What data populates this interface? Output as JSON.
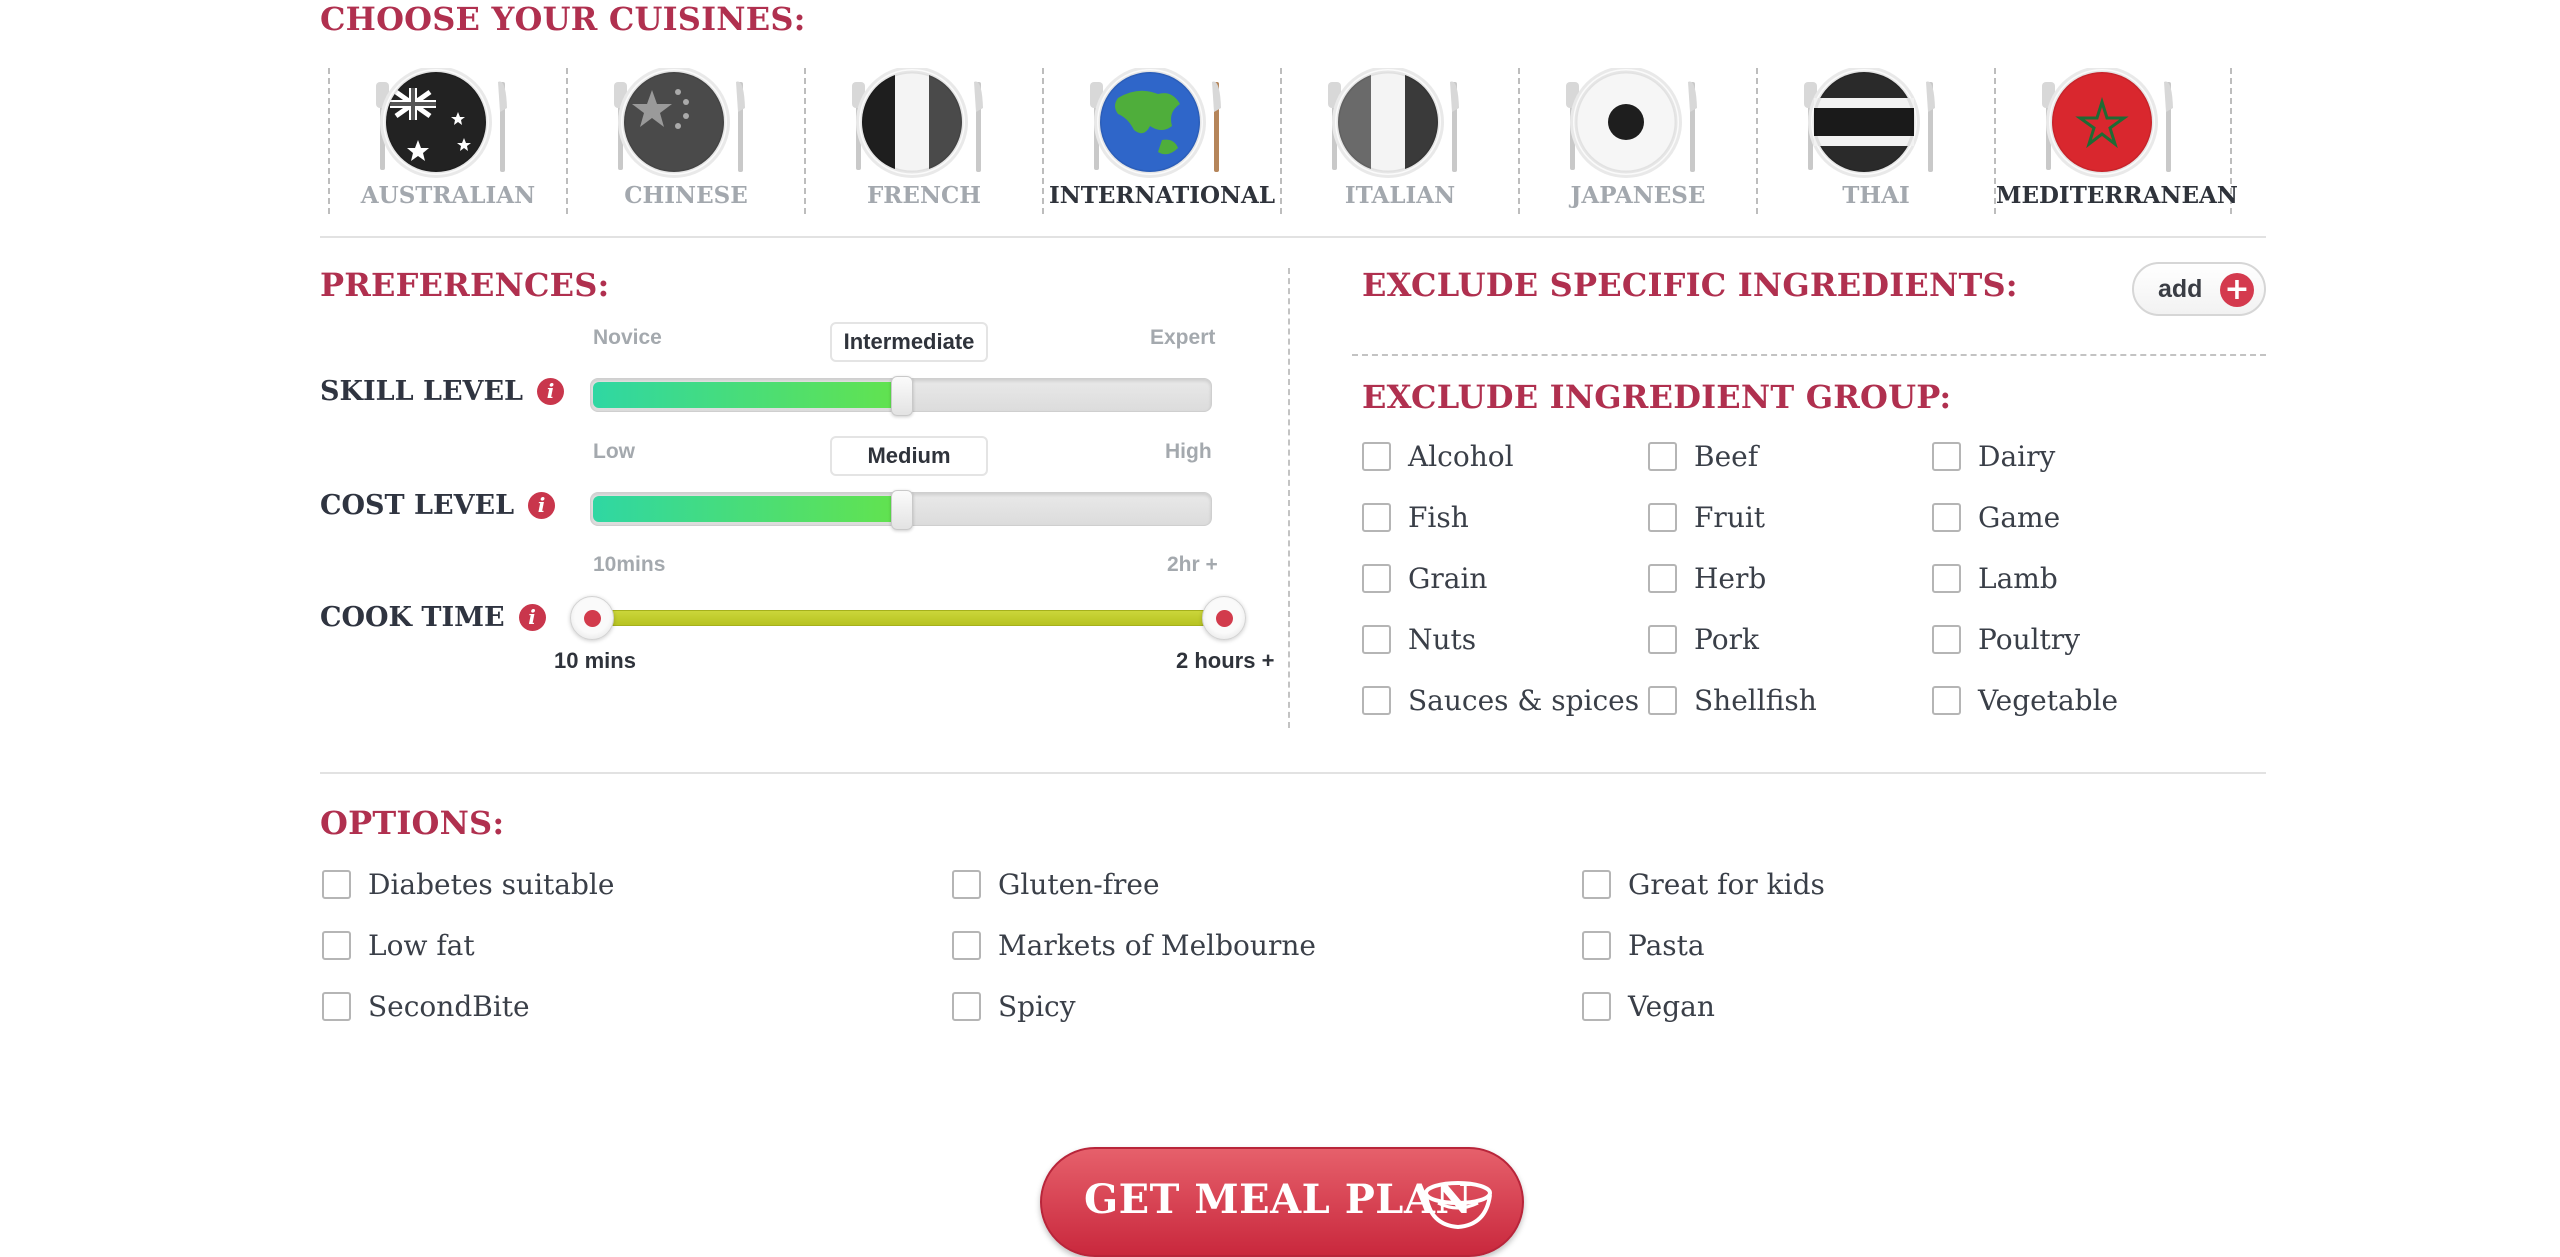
{
  "cuisines": {
    "title": "CHOOSE YOUR CUISINES:",
    "items": [
      {
        "label": "AUSTRALIAN",
        "selected": false,
        "icon": "australia-flag-plate-icon"
      },
      {
        "label": "CHINESE",
        "selected": false,
        "icon": "china-flag-plate-icon"
      },
      {
        "label": "FRENCH",
        "selected": false,
        "icon": "france-flag-plate-icon"
      },
      {
        "label": "INTERNATIONAL",
        "selected": true,
        "icon": "globe-plate-icon"
      },
      {
        "label": "ITALIAN",
        "selected": false,
        "icon": "italy-flag-plate-icon"
      },
      {
        "label": "JAPANESE",
        "selected": false,
        "icon": "japan-flag-plate-icon"
      },
      {
        "label": "THAI",
        "selected": false,
        "icon": "thailand-flag-plate-icon"
      },
      {
        "label": "MEDITERRANEAN",
        "selected": true,
        "icon": "morocco-flag-plate-icon"
      }
    ]
  },
  "preferences": {
    "title": "PREFERENCES:",
    "skill": {
      "label": "SKILL LEVEL",
      "min": "Novice",
      "max": "Expert",
      "value": "Intermediate",
      "level": 0.5
    },
    "cost": {
      "label": "COST LEVEL",
      "min": "Low",
      "max": "High",
      "value": "Medium",
      "level": 0.5
    },
    "cook": {
      "label": "COOK TIME",
      "min": "10mins",
      "max": "2hr +",
      "from": "10 mins",
      "to": "2 hours +"
    },
    "info_glyph": "i"
  },
  "exclude_ingredients": {
    "title": "EXCLUDE SPECIFIC INGREDIENTS:",
    "add_label": "add",
    "add_glyph": "+"
  },
  "exclude_groups": {
    "title": "EXCLUDE INGREDIENT GROUP:",
    "items": [
      "Alcohol",
      "Beef",
      "Dairy",
      "Fish",
      "Fruit",
      "Game",
      "Grain",
      "Herb",
      "Lamb",
      "Nuts",
      "Pork",
      "Poultry",
      "Sauces & spices",
      "Shellfish",
      "Vegetable"
    ]
  },
  "options": {
    "title": "OPTIONS:",
    "items": [
      "Diabetes suitable",
      "Gluten-free",
      "Great for kids",
      "Low fat",
      "Markets of Melbourne",
      "Pasta",
      "SecondBite",
      "Spicy",
      "Vegan"
    ]
  },
  "cta": {
    "label": "GET MEAL PLAN",
    "icon": "bowl-icon"
  },
  "colors": {
    "accent": "#b0304f",
    "button": "#d43a4e",
    "slider_fill": "#3fdc8f",
    "cook_track": "#c2cd2b"
  }
}
